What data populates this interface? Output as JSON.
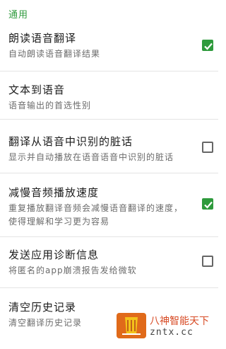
{
  "section": {
    "title": "通用"
  },
  "prefs": [
    {
      "title": "朗读语音翻译",
      "summary": "自动朗读语音翻译结果",
      "checkbox": true,
      "checked": true
    },
    {
      "title": "文本到语音",
      "summary": "语音输出的首选性别",
      "checkbox": false,
      "checked": false
    },
    {
      "title": "翻译从语音中识别的脏话",
      "summary": "显示并自动播放在语音语音中识别的脏话",
      "checkbox": true,
      "checked": false
    },
    {
      "title": "减慢音频播放速度",
      "summary": "重复播放翻译音频会减慢语音翻译的速度，使得理解和学习更为容易",
      "checkbox": true,
      "checked": true
    },
    {
      "title": "发送应用诊断信息",
      "summary": "将匿名的app崩溃报告发给微软",
      "checkbox": true,
      "checked": false
    },
    {
      "title": "清空历史记录",
      "summary": "清空翻译历史记录",
      "checkbox": false,
      "checked": false
    }
  ],
  "watermark": {
    "line1": "八神智能天下",
    "line2": "zntx.cc"
  },
  "colors": {
    "accent": "#2e9a3c",
    "watermark_red": "#d74a24"
  },
  "icons": {
    "checkbox": "check-icon",
    "watermark": "broom-logo-icon"
  }
}
